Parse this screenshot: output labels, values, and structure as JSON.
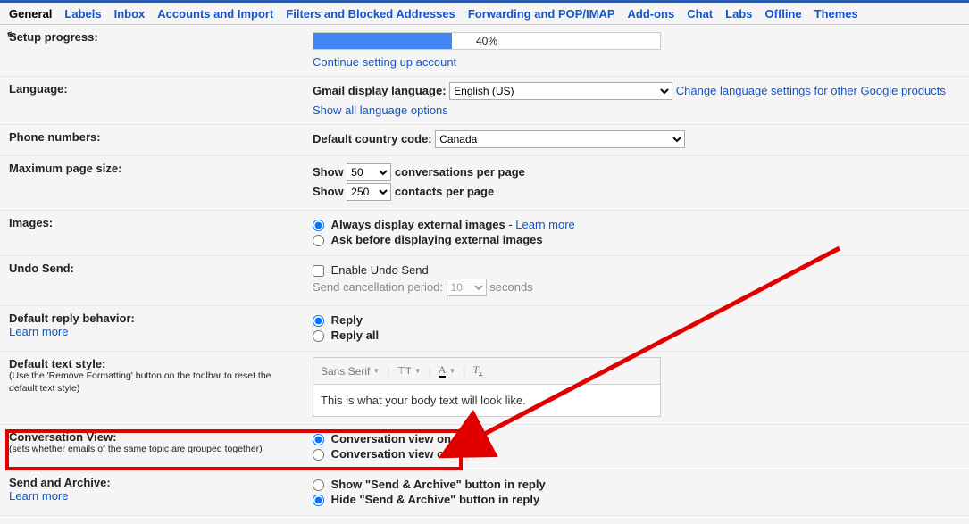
{
  "tabs": {
    "general": "General",
    "labels": "Labels",
    "inbox": "Inbox",
    "accounts": "Accounts and Import",
    "filters": "Filters and Blocked Addresses",
    "forwarding": "Forwarding and POP/IMAP",
    "addons": "Add-ons",
    "chat": "Chat",
    "labs": "Labs",
    "offline": "Offline",
    "themes": "Themes"
  },
  "setup": {
    "label": "Setup progress:",
    "pct_text": "40%",
    "pct_num": 40,
    "continue": "Continue setting up account"
  },
  "language": {
    "label": "Language:",
    "display_label": "Gmail display language:",
    "selected": "English (US)",
    "change_link": "Change language settings for other Google products",
    "show_all": "Show all language options"
  },
  "phone": {
    "label": "Phone numbers:",
    "code_label": "Default country code:",
    "selected": "Canada"
  },
  "pagesize": {
    "label": "Maximum page size:",
    "show": "Show",
    "conv_val": "50",
    "conv_suffix": "conversations per page",
    "cont_val": "250",
    "cont_suffix": "contacts per page"
  },
  "images": {
    "label": "Images:",
    "always": "Always display external images",
    "dash": " - ",
    "learn": "Learn more",
    "ask": "Ask before displaying external images"
  },
  "undo": {
    "label": "Undo Send:",
    "enable": "Enable Undo Send",
    "period_label": "Send cancellation period:",
    "period_val": "10",
    "seconds": "seconds"
  },
  "reply": {
    "label": "Default reply behavior:",
    "learn": "Learn more",
    "reply": "Reply",
    "replyall": "Reply all"
  },
  "textstyle": {
    "label": "Default text style:",
    "sub": "(Use the 'Remove Formatting' button on the toolbar to reset the default text style)",
    "font": "Sans Serif",
    "preview": "This is what your body text will look like."
  },
  "conversation": {
    "label": "Conversation View:",
    "sub": "(sets whether emails of the same topic are grouped together)",
    "on": "Conversation view on",
    "off": "Conversation view off"
  },
  "sendarchive": {
    "label": "Send and Archive:",
    "learn": "Learn more",
    "show": "Show \"Send & Archive\" button in reply",
    "hide": "Hide \"Send & Archive\" button in reply"
  }
}
